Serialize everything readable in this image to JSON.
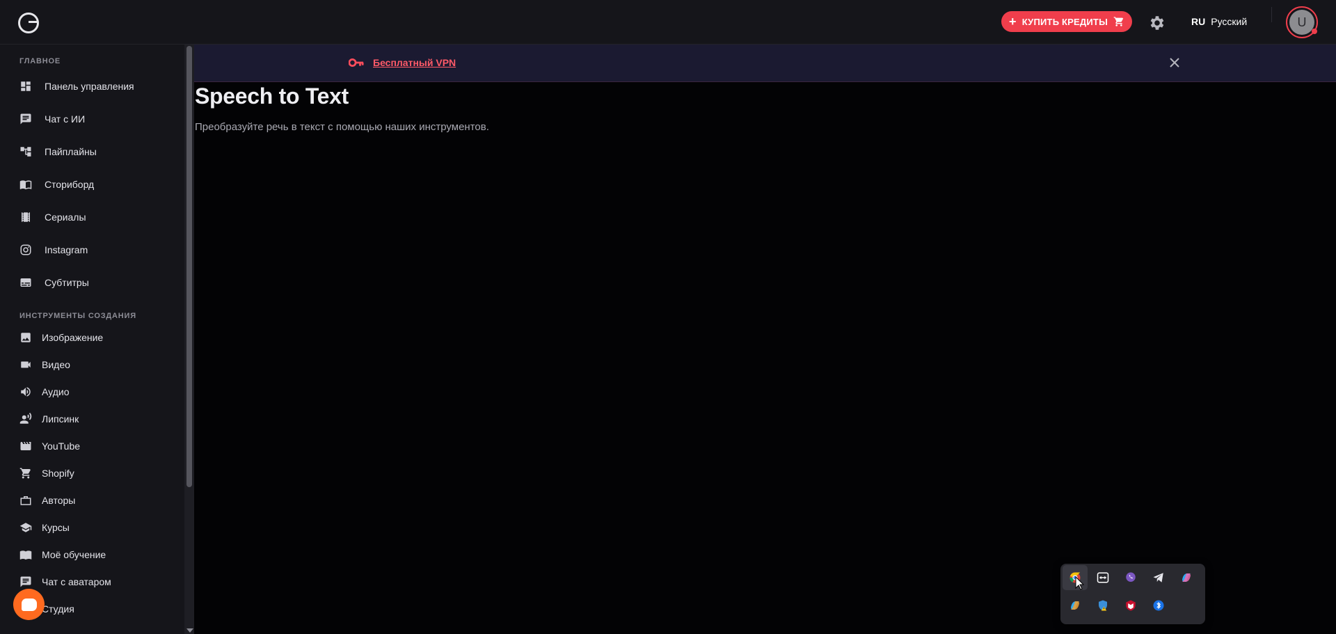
{
  "header": {
    "buy_credits_label": "КУПИТЬ КРЕДИТЫ",
    "lang_code": "RU",
    "lang_name": "Русский",
    "avatar_initial": "U"
  },
  "banner": {
    "link_text": "Бесплатный VPN"
  },
  "sidebar": {
    "section_main": "ГЛАВНОЕ",
    "main_items": [
      {
        "label": "Панель управления",
        "icon": "dashboard-icon"
      },
      {
        "label": "Чат с ИИ",
        "icon": "chat-icon"
      },
      {
        "label": "Пайплайны",
        "icon": "pipeline-icon"
      },
      {
        "label": "Сториборд",
        "icon": "storyboard-icon"
      },
      {
        "label": "Сериалы",
        "icon": "film-strip-icon"
      },
      {
        "label": "Instagram",
        "icon": "instagram-icon"
      },
      {
        "label": "Субтитры",
        "icon": "subtitles-icon"
      }
    ],
    "section_tools": "ИНСТРУМЕНТЫ СОЗДАНИЯ",
    "tool_items": [
      {
        "label": "Изображение",
        "icon": "image-icon"
      },
      {
        "label": "Видео",
        "icon": "video-icon"
      },
      {
        "label": "Аудио",
        "icon": "audio-icon"
      },
      {
        "label": "Липсинк",
        "icon": "lipsync-icon"
      },
      {
        "label": "YouTube",
        "icon": "movie-icon"
      },
      {
        "label": "Shopify",
        "icon": "cart-icon"
      },
      {
        "label": "Авторы",
        "icon": "briefcase-icon"
      },
      {
        "label": "Курсы",
        "icon": "school-icon"
      },
      {
        "label": "Моё обучение",
        "icon": "book-icon"
      },
      {
        "label": "Чат с аватаром",
        "icon": "chat-icon"
      },
      {
        "label": "Студия",
        "icon": "studio-icon"
      }
    ]
  },
  "main": {
    "title": "Speech to Text",
    "subtitle": "Преобразуйте речь в текст с помощью наших инструментов."
  },
  "tray": {
    "icons": [
      "chrome-icon",
      "teamviewer-icon",
      "viber-icon",
      "telegram-icon",
      "copilot-icon",
      "onedrive-icon",
      "defender-warning-icon",
      "mcafee-icon",
      "bluetooth-icon"
    ]
  },
  "colors": {
    "accent": "#f03e4c",
    "sidebar_bg": "#15151a",
    "main_bg": "#030305",
    "banner_bg": "#1b1a31"
  }
}
